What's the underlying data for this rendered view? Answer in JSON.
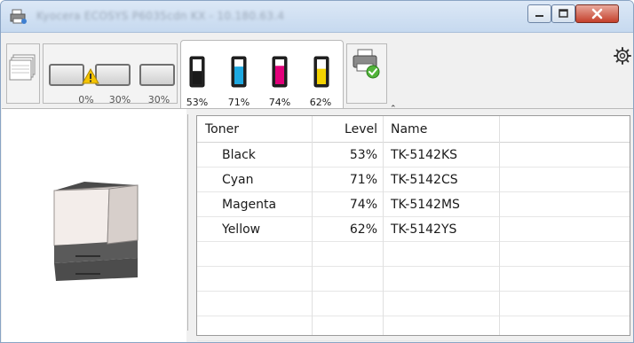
{
  "window": {
    "title": "Kyocera ECOSYS P6035cdn KX - 10.180.63.4"
  },
  "tabs": {
    "trays": [
      {
        "pct": "0%"
      },
      {
        "pct": "30%"
      },
      {
        "pct": "30%"
      }
    ],
    "toner": [
      {
        "pct": "53%",
        "color": "#1a1a1a",
        "level": 0.53
      },
      {
        "pct": "71%",
        "color": "#1ea9e1",
        "level": 0.71
      },
      {
        "pct": "74%",
        "color": "#e2007a",
        "level": 0.74
      },
      {
        "pct": "62%",
        "color": "#f3d200",
        "level": 0.62
      }
    ],
    "collapse_glyph": "⌃"
  },
  "table": {
    "headers": {
      "toner": "Toner",
      "level": "Level",
      "name": "Name"
    },
    "rows": [
      {
        "toner": "Black",
        "level": "53%",
        "name": "TK-5142KS"
      },
      {
        "toner": "Cyan",
        "level": "71%",
        "name": "TK-5142CS"
      },
      {
        "toner": "Magenta",
        "level": "74%",
        "name": "TK-5142MS"
      },
      {
        "toner": "Yellow",
        "level": "62%",
        "name": "TK-5142YS"
      }
    ]
  }
}
